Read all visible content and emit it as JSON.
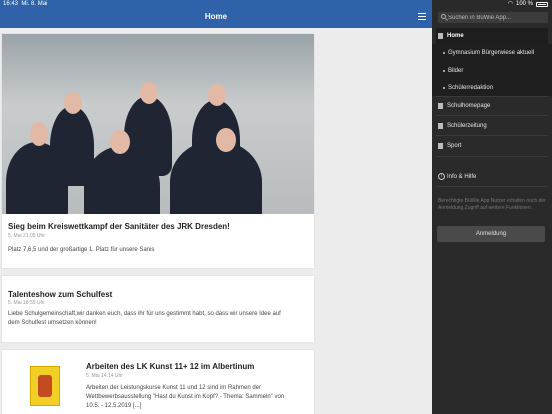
{
  "status": {
    "time": "16:43",
    "date": "Mi. 8. Mai",
    "battery": "100 %"
  },
  "header": {
    "title": "Home"
  },
  "posts": [
    {
      "title": "Sieg beim Kreiswettkampf der Sanitäter des JRK Dresden!",
      "date": "5. Mai 21:05 Uhr",
      "text": "Platz 7,6,5 und der großartige 1. Platz für unsere Sanis"
    },
    {
      "title": "Talenteshow zum Schulfest",
      "date": "5. Mai 18:55 Uhr",
      "text_line1": "Liebe Schulgemeinschaft,wir danken euch, dass ihr für uns gestimmt habt, so dass wir unsere Idee auf",
      "text_line2": "dem Schulfest umsetzen können!"
    },
    {
      "title": "Arbeiten des LK Kunst 11+ 12 im Albertinum",
      "date": "5. Mai 14:14 Uhr",
      "text_line1": "Arbeiten der Leistungskurse Kunst 11 und 12 sind im Rahmen der",
      "text_line2": "Wettbewerbsausstellung \"Hast du Kunst im Kopf? - Thema: Sammeln\" von",
      "text_line3": "10.5. - 12.5.2019 [...]"
    }
  ],
  "sidebar": {
    "search_placeholder": "Suchen in BüWie App...",
    "home": "Home",
    "sub_items": [
      "Gymnasium Bürgerwiese aktuell",
      "Bilder",
      "Schülerredaktion"
    ],
    "items": [
      "Schulhomepage",
      "Schülerzeitung",
      "Sport"
    ],
    "info": "Info & Hilfe",
    "note": "Berechtigte BüWie App Nutzer erhalten nach der Anmeldung Zugriff auf weitere Funktionen.",
    "login": "Anmeldung"
  }
}
